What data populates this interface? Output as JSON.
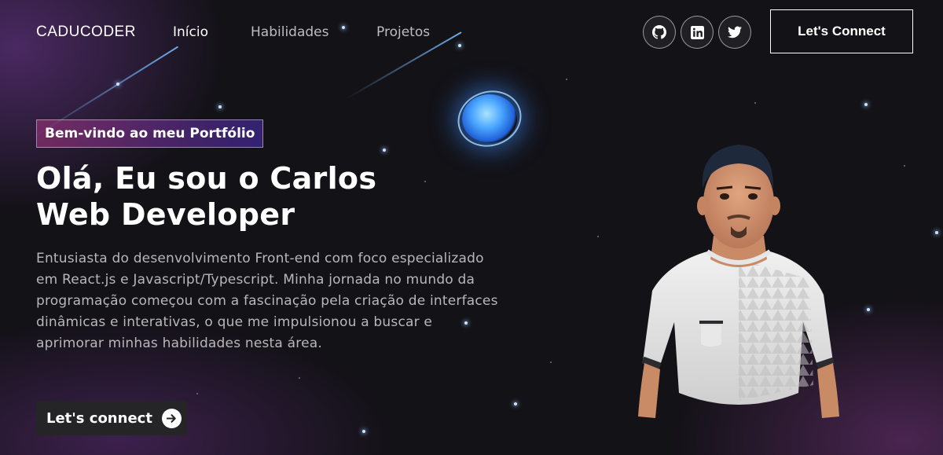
{
  "nav": {
    "logo": "CADUCODER",
    "links": [
      "Início",
      "Habilidades",
      "Projetos"
    ],
    "socials": [
      {
        "icon": "github-icon"
      },
      {
        "icon": "linkedin-icon"
      },
      {
        "icon": "twitter-icon"
      }
    ],
    "connect_label": "Let's Connect"
  },
  "hero": {
    "tagline": "Bem-vindo ao meu Portfólio",
    "headline_line1": "Olá, Eu sou o Carlos",
    "headline_line2": "Web Developer",
    "intro_lines": [
      "Entusiasta do desenvolvimento Front-end com foco especializado",
      "em React.js e Javascript/Typescript. Minha jornada no mundo da",
      "programação começou com a fascinação pela criação de interfaces",
      "dinâmicas e interativas, o que me impulsionou a buscar e",
      "aprimorar minhas habilidades nesta área."
    ],
    "cta_label": "Let's connect",
    "cta_icon": "arrow-right-circle-icon"
  },
  "colors": {
    "background": "#131217",
    "tagline_gradient_start": "#aa367c",
    "tagline_gradient_end": "#4a2fbd",
    "text_muted": "#b8b8b8"
  }
}
